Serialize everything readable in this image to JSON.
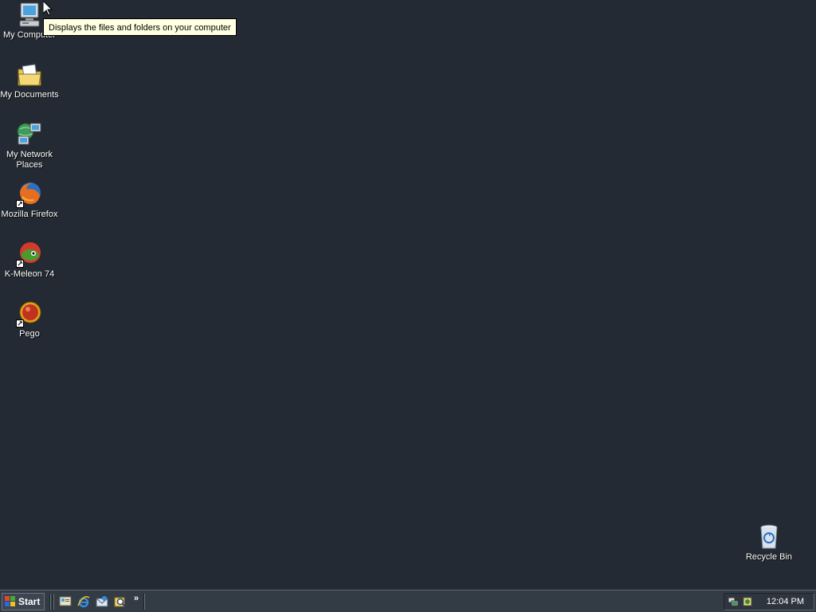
{
  "desktop": {
    "icons": [
      {
        "label": "My Computer",
        "icon": "my-computer-icon"
      },
      {
        "label": "My Documents",
        "icon": "my-documents-icon"
      },
      {
        "label": "My Network Places",
        "icon": "network-places-icon"
      },
      {
        "label": "Mozilla Firefox",
        "icon": "firefox-icon"
      },
      {
        "label": "K-Meleon 74",
        "icon": "k-meleon-icon"
      },
      {
        "label": "Pego",
        "icon": "pego-icon"
      },
      {
        "label": "Recycle Bin",
        "icon": "recycle-bin-icon"
      }
    ],
    "tooltip": "Displays the files and folders on your computer"
  },
  "taskbar": {
    "start_label": "Start",
    "quick_launch": [
      "show-desktop-icon",
      "internet-explorer-icon",
      "outlook-express-icon",
      "search-icon"
    ],
    "chevron": "»",
    "tray_icons": [
      "network-tray-icon",
      "safely-remove-tray-icon"
    ],
    "clock": "12:04 PM"
  },
  "colors": {
    "desktop_bg": "#232a33",
    "taskbar_bg": "#333b45",
    "tooltip_bg": "#ffffe1"
  }
}
